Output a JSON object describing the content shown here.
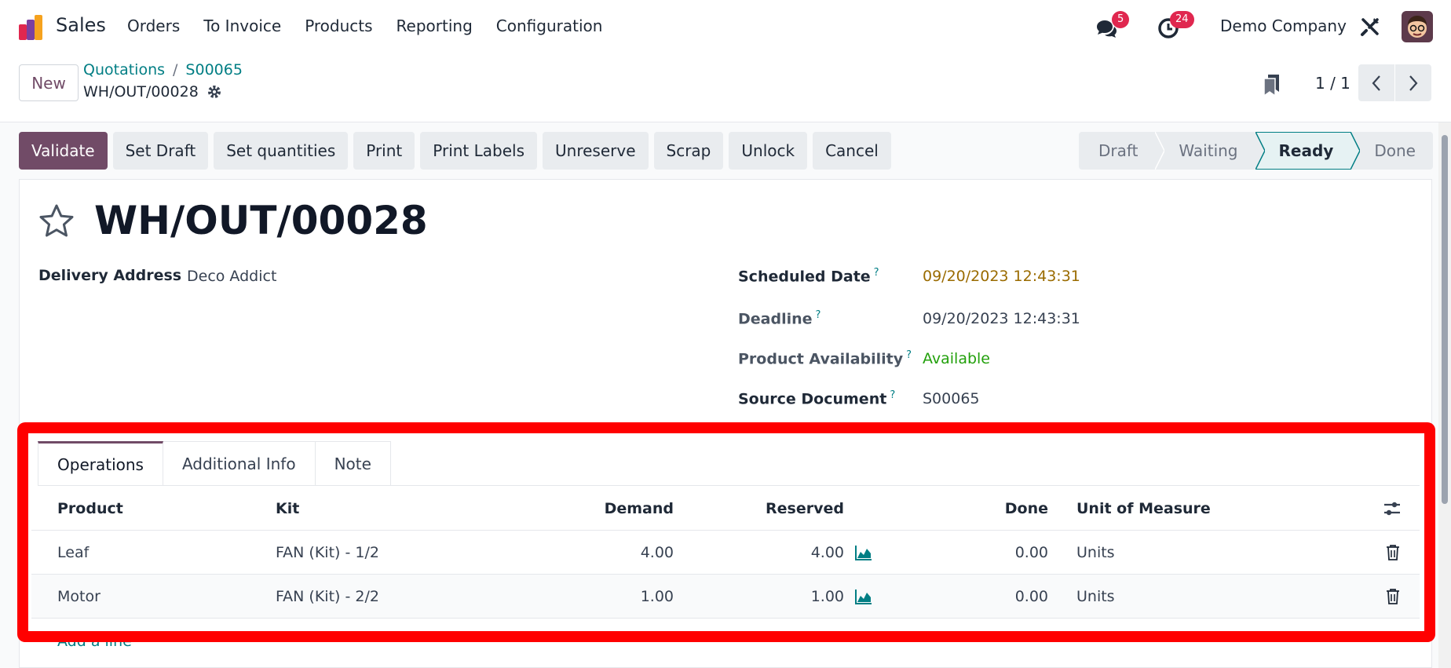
{
  "navbar": {
    "app_name": "Sales",
    "menu": [
      "Orders",
      "To Invoice",
      "Products",
      "Reporting",
      "Configuration"
    ],
    "messages_count": "5",
    "activities_count": "24",
    "company": "Demo Company"
  },
  "control_panel": {
    "new_label": "New",
    "breadcrumbs": [
      "Quotations",
      "S00065"
    ],
    "record_name": "WH/OUT/00028",
    "pager": "1 / 1"
  },
  "actions": [
    "Validate",
    "Set Draft",
    "Set quantities",
    "Print",
    "Print Labels",
    "Unreserve",
    "Scrap",
    "Unlock",
    "Cancel"
  ],
  "status": {
    "stages": [
      "Draft",
      "Waiting",
      "Ready",
      "Done"
    ],
    "current": "Ready"
  },
  "record": {
    "title": "WH/OUT/00028",
    "delivery_address_label": "Delivery Address",
    "delivery_address": "Deco Addict",
    "scheduled_date_label": "Scheduled Date",
    "scheduled_date": "09/20/2023 12:43:31",
    "deadline_label": "Deadline",
    "deadline": "09/20/2023 12:43:31",
    "availability_label": "Product Availability",
    "availability": "Available",
    "source_label": "Source Document",
    "source": "S00065",
    "help_mark": "?"
  },
  "notebook": {
    "tabs": [
      "Operations",
      "Additional Info",
      "Note"
    ]
  },
  "operations": {
    "headers": [
      "Product",
      "Kit",
      "Demand",
      "Reserved",
      "Done",
      "Unit of Measure"
    ],
    "rows": [
      {
        "product": "Leaf",
        "kit": "FAN (Kit) - 1/2",
        "demand": "4.00",
        "reserved": "4.00",
        "done": "0.00",
        "uom": "Units"
      },
      {
        "product": "Motor",
        "kit": "FAN (Kit) - 2/2",
        "demand": "1.00",
        "reserved": "1.00",
        "done": "0.00",
        "uom": "Units"
      }
    ],
    "add_line": "Add a line"
  },
  "colors": {
    "brand": "#714b67",
    "link": "#017e84",
    "highlight": "#ff0000",
    "scheduled": "#9a6b00",
    "available": "#22a00b"
  }
}
